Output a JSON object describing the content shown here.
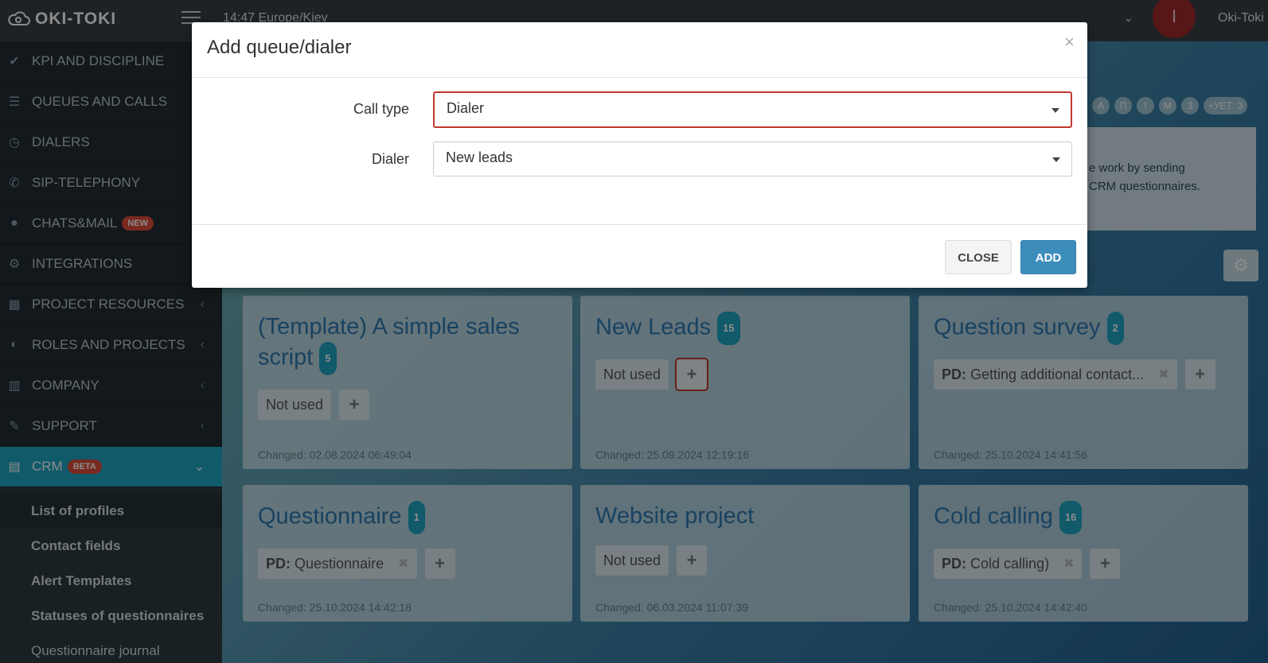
{
  "topbar": {
    "logo": "OKI-TOKI",
    "clock": "14:47  Europe/Kiev",
    "avatar_letter": "I",
    "user_name": "Oki-Toki"
  },
  "sidebar": {
    "items": [
      {
        "label": "KPI AND DISCIPLINE",
        "icon": "check-icon"
      },
      {
        "label": "QUEUES AND CALLS",
        "icon": "list-icon"
      },
      {
        "label": "DIALERS",
        "icon": "clock-icon"
      },
      {
        "label": "SIP-TELEPHONY",
        "icon": "phone-icon"
      },
      {
        "label": "CHATS&MAIL",
        "icon": "chat-icon",
        "badge": "NEW"
      },
      {
        "label": "INTEGRATIONS",
        "icon": "cogs-icon"
      },
      {
        "label": "PROJECT RESOURCES",
        "icon": "grid-icon"
      },
      {
        "label": "ROLES AND PROJECTS",
        "icon": "toggle-icon"
      },
      {
        "label": "COMPANY",
        "icon": "bar-chart-icon"
      },
      {
        "label": "SUPPORT",
        "icon": "wrench-icon"
      },
      {
        "label": "CRM",
        "icon": "crm-icon",
        "badge": "BETA"
      }
    ],
    "submenu": [
      "List of profiles",
      "Contact fields",
      "Alert Templates",
      "Statuses of questionnaires",
      "Questionnaire journal"
    ]
  },
  "main": {
    "pills": [
      "А",
      "П",
      "І",
      "М",
      "З",
      "+УЕТ: 3"
    ],
    "info_line1": "e work by sending",
    "info_line2": "CRM questionnaires.",
    "cards": [
      {
        "title": "(Template) A simple sales script",
        "count": "5",
        "chip": "Not used",
        "changed": "Changed: 02.08.2024 06:49:04"
      },
      {
        "title": "New Leads",
        "count": "15",
        "chip": "Not used",
        "changed": "Changed: 25.09.2024 12:19:16"
      },
      {
        "title": "Question survey",
        "count": "2",
        "chip_prefix": "PD:",
        "chip": "Getting additional contact...",
        "changed": "Changed: 25.10.2024 14:41:56"
      },
      {
        "title": "Questionnaire",
        "count": "1",
        "chip_prefix": "PD:",
        "chip": "Questionnaire",
        "changed": "Changed: 25.10.2024 14:42:18"
      },
      {
        "title": "Website project",
        "chip": "Not used",
        "changed": "Changed: 06.03.2024 11:07:39"
      },
      {
        "title": "Cold calling",
        "count": "16",
        "chip_prefix": "PD:",
        "chip": "Cold calling)",
        "changed": "Changed: 25.10.2024 14:42:40"
      }
    ]
  },
  "modal": {
    "title": "Add queue/dialer",
    "close_x": "×",
    "call_type_label": "Call type",
    "call_type_value": "Dialer",
    "dialer_label": "Dialer",
    "dialer_value": "New leads",
    "close_button": "CLOSE",
    "add_button": "ADD"
  },
  "colors": {
    "accent": "#1ea5c2",
    "primary_button": "#3c8dbc",
    "highlight": "#c0392b",
    "badge": "#dd4b39"
  }
}
